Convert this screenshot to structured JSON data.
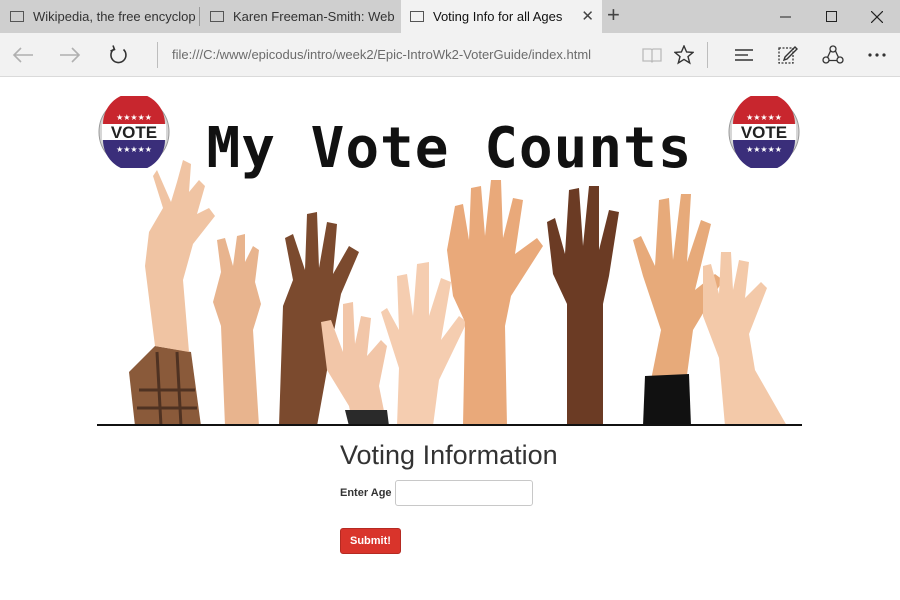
{
  "browser": {
    "tabs": [
      {
        "title": "Wikipedia, the free encyclop",
        "active": false
      },
      {
        "title": "Karen Freeman-Smith: Web",
        "active": false
      },
      {
        "title": "Voting Info for all Ages",
        "active": true
      }
    ],
    "url": "file:///C:/www/epicodus/intro/week2/Epic-IntroWk2-VoterGuide/index.html",
    "icons": {
      "back": "back-arrow-icon",
      "forward": "forward-arrow-icon",
      "refresh": "refresh-icon",
      "reading_view": "reading-view-icon",
      "favorite": "star-icon",
      "hub": "hub-icon",
      "web_note": "web-note-icon",
      "share": "share-icon",
      "more": "more-icon"
    }
  },
  "page": {
    "banner": {
      "title": "My Vote Counts",
      "badge_text": "VOTE",
      "badge_colors": {
        "red": "#c8262e",
        "blue": "#3a2e7a",
        "silver": "#d6d6d6"
      }
    },
    "heading": "Voting Information",
    "age_label": "Enter Age",
    "age_value": "",
    "submit_label": "Submit!"
  }
}
